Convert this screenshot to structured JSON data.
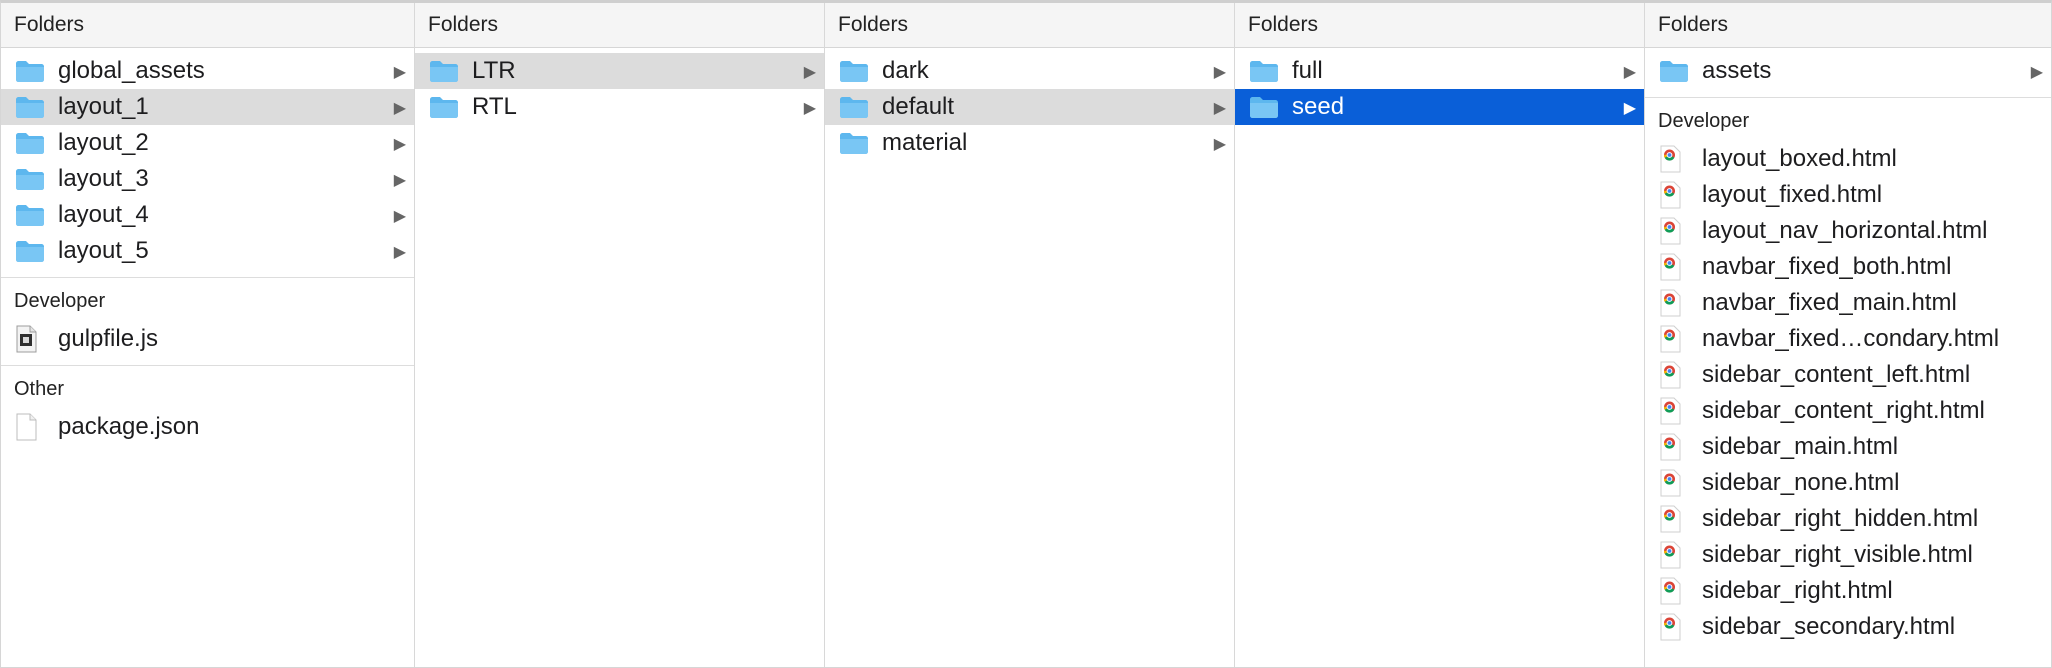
{
  "columns": [
    {
      "header": "Folders",
      "folders": [
        {
          "label": "global_assets",
          "state": "none"
        },
        {
          "label": "layout_1",
          "state": "gray"
        },
        {
          "label": "layout_2",
          "state": "none"
        },
        {
          "label": "layout_3",
          "state": "none"
        },
        {
          "label": "layout_4",
          "state": "none"
        },
        {
          "label": "layout_5",
          "state": "none"
        }
      ],
      "developer_title": "Developer",
      "developer_files": [
        {
          "label": "gulpfile.js",
          "icon": "js-file-icon"
        }
      ],
      "other_title": "Other",
      "other_files": [
        {
          "label": "package.json",
          "icon": "document-icon"
        }
      ]
    },
    {
      "header": "Folders",
      "folders": [
        {
          "label": "LTR",
          "state": "gray"
        },
        {
          "label": "RTL",
          "state": "none"
        }
      ]
    },
    {
      "header": "Folders",
      "folders": [
        {
          "label": "dark",
          "state": "none"
        },
        {
          "label": "default",
          "state": "gray"
        },
        {
          "label": "material",
          "state": "none"
        }
      ]
    },
    {
      "header": "Folders",
      "folders": [
        {
          "label": "full",
          "state": "none"
        },
        {
          "label": "seed",
          "state": "blue"
        }
      ]
    },
    {
      "header": "Folders",
      "folders": [
        {
          "label": "assets",
          "state": "none"
        }
      ],
      "developer_title": "Developer",
      "developer_files": [
        {
          "label": "layout_boxed.html",
          "icon": "chrome-html-icon"
        },
        {
          "label": "layout_fixed.html",
          "icon": "chrome-html-icon"
        },
        {
          "label": "layout_nav_horizontal.html",
          "icon": "chrome-html-icon"
        },
        {
          "label": "navbar_fixed_both.html",
          "icon": "chrome-html-icon"
        },
        {
          "label": "navbar_fixed_main.html",
          "icon": "chrome-html-icon"
        },
        {
          "label": "navbar_fixed…condary.html",
          "icon": "chrome-html-icon"
        },
        {
          "label": "sidebar_content_left.html",
          "icon": "chrome-html-icon"
        },
        {
          "label": "sidebar_content_right.html",
          "icon": "chrome-html-icon"
        },
        {
          "label": "sidebar_main.html",
          "icon": "chrome-html-icon"
        },
        {
          "label": "sidebar_none.html",
          "icon": "chrome-html-icon"
        },
        {
          "label": "sidebar_right_hidden.html",
          "icon": "chrome-html-icon"
        },
        {
          "label": "sidebar_right_visible.html",
          "icon": "chrome-html-icon"
        },
        {
          "label": "sidebar_right.html",
          "icon": "chrome-html-icon"
        },
        {
          "label": "sidebar_secondary.html",
          "icon": "chrome-html-icon"
        }
      ]
    }
  ],
  "colors": {
    "folder": "#79c6f4",
    "folder_dark": "#5db7ee",
    "selected_gray": "#dcdcdc",
    "selected_blue": "#0a5fd8"
  },
  "disclosure_glyph": "▶"
}
